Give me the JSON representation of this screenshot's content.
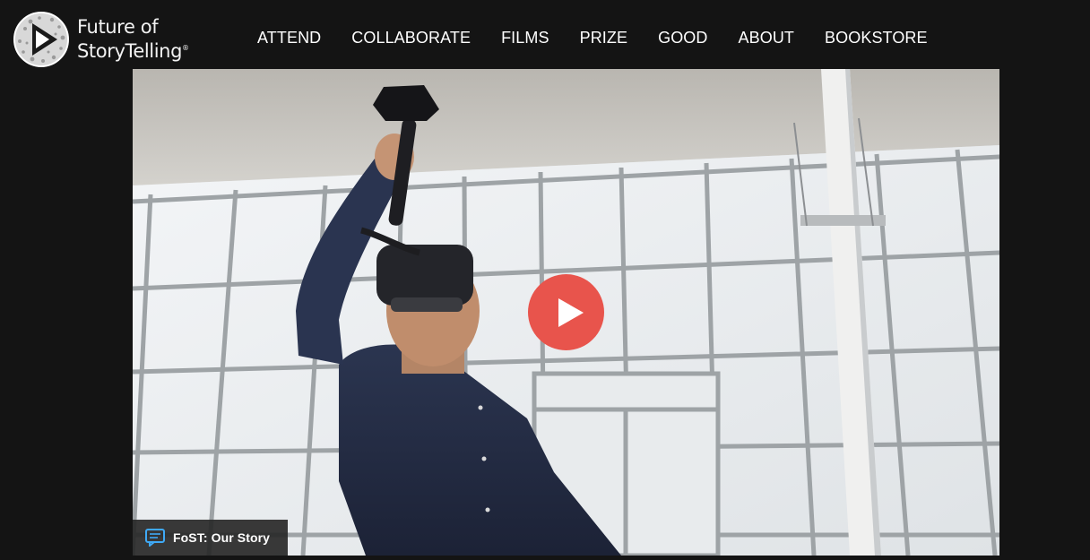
{
  "brand": {
    "line1": "Future of",
    "line2": "StoryTelling",
    "mark": "®"
  },
  "nav": {
    "items": [
      {
        "label": "ATTEND"
      },
      {
        "label": "COLLABORATE"
      },
      {
        "label": "FILMS"
      },
      {
        "label": "PRIZE"
      },
      {
        "label": "GOOD"
      },
      {
        "label": "ABOUT"
      },
      {
        "label": "BOOKSTORE"
      }
    ]
  },
  "video": {
    "title": "FoST: Our Story",
    "play_icon": "play-icon",
    "caption_icon": "speech-bubble-icon",
    "accent_color": "#e8544c"
  }
}
